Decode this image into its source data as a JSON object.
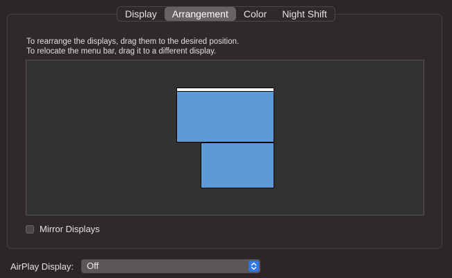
{
  "tabs": [
    {
      "label": "Display",
      "selected": false
    },
    {
      "label": "Arrangement",
      "selected": true
    },
    {
      "label": "Color",
      "selected": false
    },
    {
      "label": "Night Shift",
      "selected": false
    }
  ],
  "instructions": {
    "line1": "To rearrange the displays, drag them to the desired position.",
    "line2": "To relocate the menu bar, drag it to a different display."
  },
  "displays": {
    "main": {
      "has_menu_bar": true
    },
    "secondary": {
      "has_menu_bar": false
    }
  },
  "mirror": {
    "label": "Mirror Displays",
    "checked": false
  },
  "airplay": {
    "label": "AirPlay Display:",
    "value": "Off",
    "icon": "chevron-up-down-icon"
  },
  "colors": {
    "display_fill": "#5e9ad3",
    "selected_tab": "#676264",
    "accent": "#2f78e6"
  }
}
